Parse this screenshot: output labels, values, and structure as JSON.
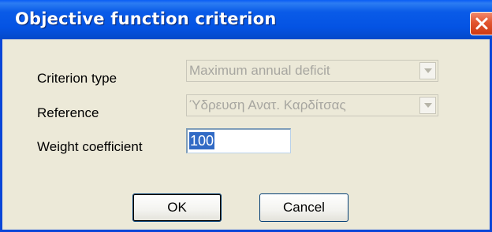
{
  "dialog": {
    "title": "Objective function criterion",
    "close_icon": "close-icon"
  },
  "fields": {
    "criterion_type": {
      "label": "Criterion type",
      "value": "Maximum annual deficit"
    },
    "reference": {
      "label": "Reference",
      "value": "Ύδρευση Ανατ. Καρδίτσας"
    },
    "weight": {
      "label": "Weight coefficient",
      "value": "100"
    }
  },
  "buttons": {
    "ok": "OK",
    "cancel": "Cancel"
  }
}
